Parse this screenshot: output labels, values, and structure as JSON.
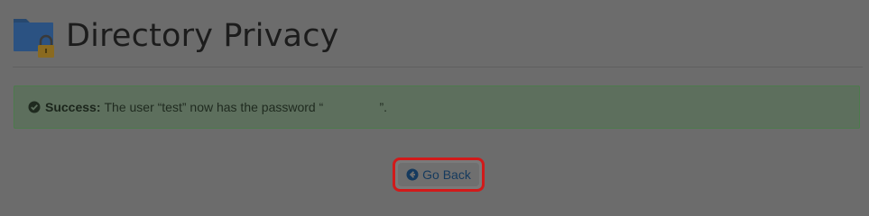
{
  "page": {
    "title": "Directory Privacy"
  },
  "alert": {
    "status_label": "Success:",
    "message": "The user “test” now has the password “                ”."
  },
  "actions": {
    "go_back_label": "Go Back"
  },
  "icons": {
    "page_icon": "folder-lock-icon",
    "alert_icon": "check-circle-icon",
    "go_back_icon": "arrow-circle-left-icon"
  },
  "colors": {
    "alert_border": "#4c7a4c",
    "highlight_border": "#d11a1a",
    "link": "#153a5e"
  }
}
